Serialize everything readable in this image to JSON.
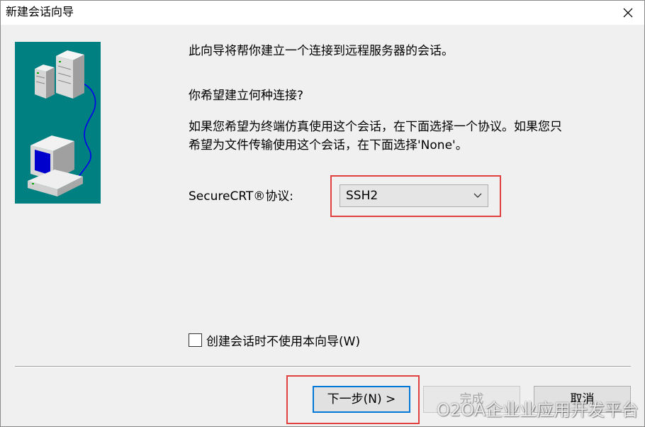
{
  "window": {
    "title": "新建会话向导",
    "close_icon": "close-icon"
  },
  "illustration": {
    "icons": [
      "server-tower-icon",
      "server-tower-icon",
      "desktop-computer-icon",
      "network-cable-icon"
    ],
    "background_color": "#008080"
  },
  "content": {
    "intro": "此向导将帮你建立一个连接到远程服务器的会话。",
    "question": "你希望建立何种连接?",
    "description_lines": [
      "如果您希望为终端仿真使用这个会话，在下面选择一个协议。如果您只",
      "希望为文件传输使用这个会话，在下面选择'None'。"
    ],
    "protocol_label": "SecureCRT®协议:",
    "protocol_value": "SSH2",
    "skip_wizard_label": "创建会话时不使用本向导(W)",
    "skip_wizard_checked": false
  },
  "buttons": {
    "next": "下一步(N) >",
    "finish": "完成",
    "cancel": "取消"
  },
  "highlight_color": "#e04040",
  "watermark": "O2OA企业业应用开发平台"
}
